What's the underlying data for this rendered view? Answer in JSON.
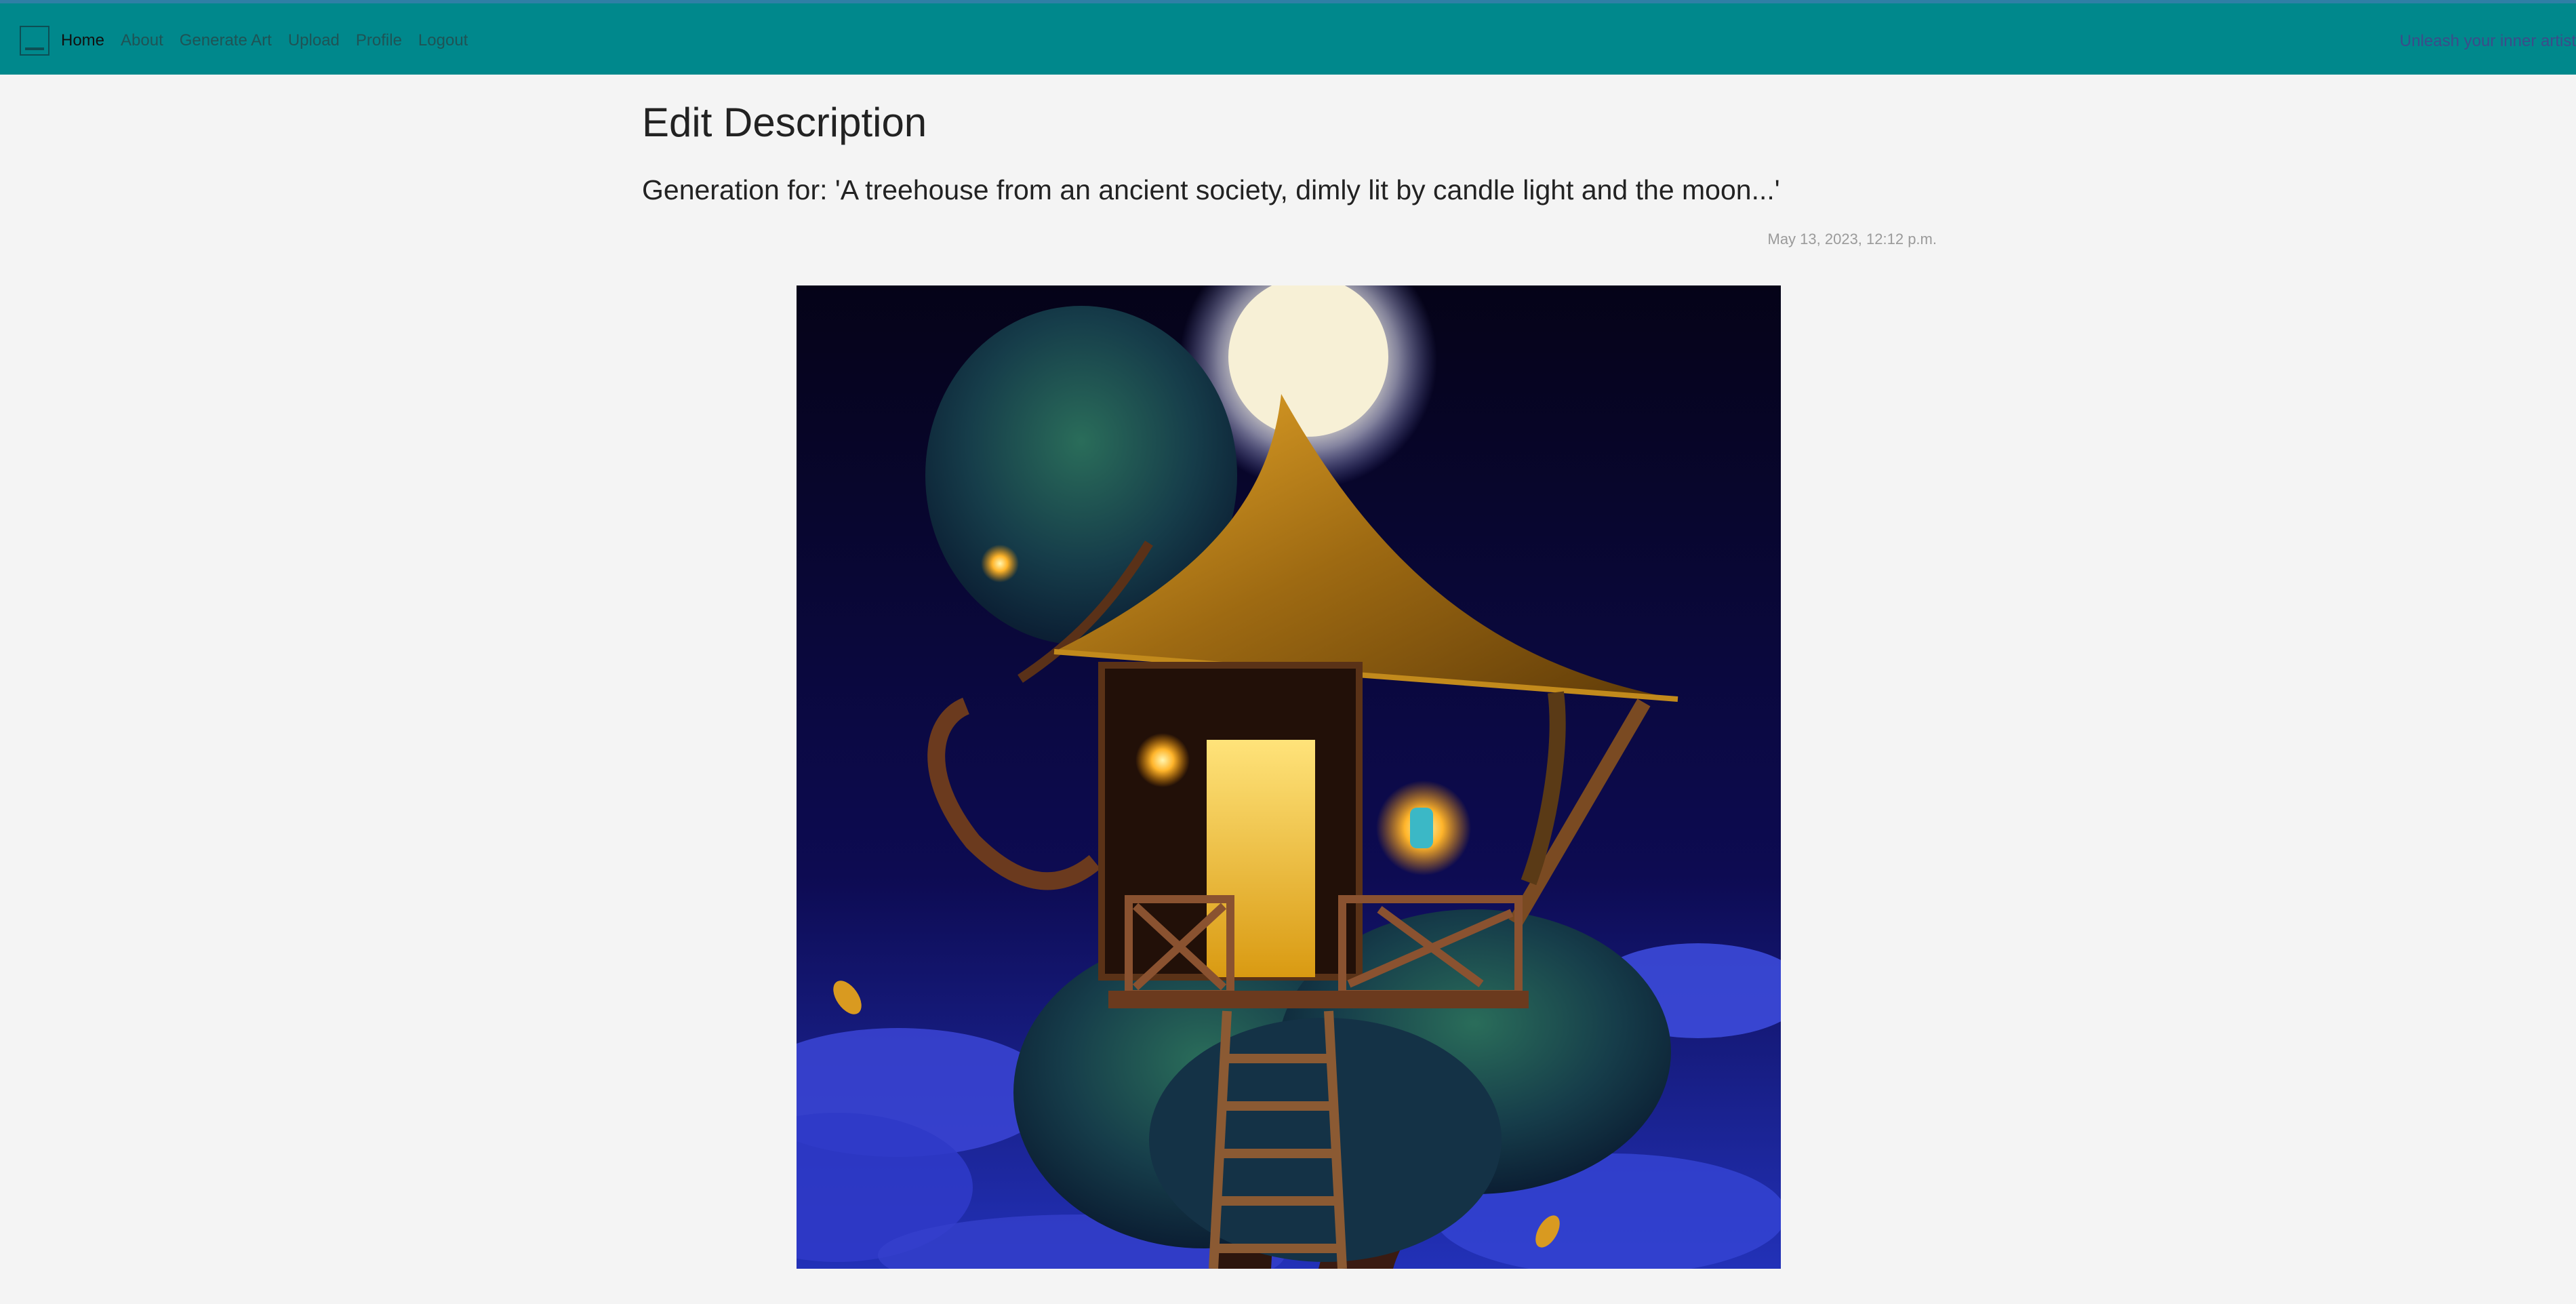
{
  "nav": {
    "items": [
      {
        "label": "Home",
        "active": true
      },
      {
        "label": "About"
      },
      {
        "label": "Generate Art"
      },
      {
        "label": "Upload"
      },
      {
        "label": "Profile"
      },
      {
        "label": "Logout"
      }
    ],
    "tagline": "Unleash your inner artist"
  },
  "page": {
    "title": "Edit Description",
    "subtitle": "Generation for: 'A treehouse from an ancient society, dimly lit by candle light and the moon...'",
    "timestamp": "May 13, 2023, 12:12 p.m."
  },
  "colors": {
    "navbar": "#00888c",
    "background": "#f4f4f4"
  },
  "icons": {
    "brand": "image-frame-icon"
  }
}
